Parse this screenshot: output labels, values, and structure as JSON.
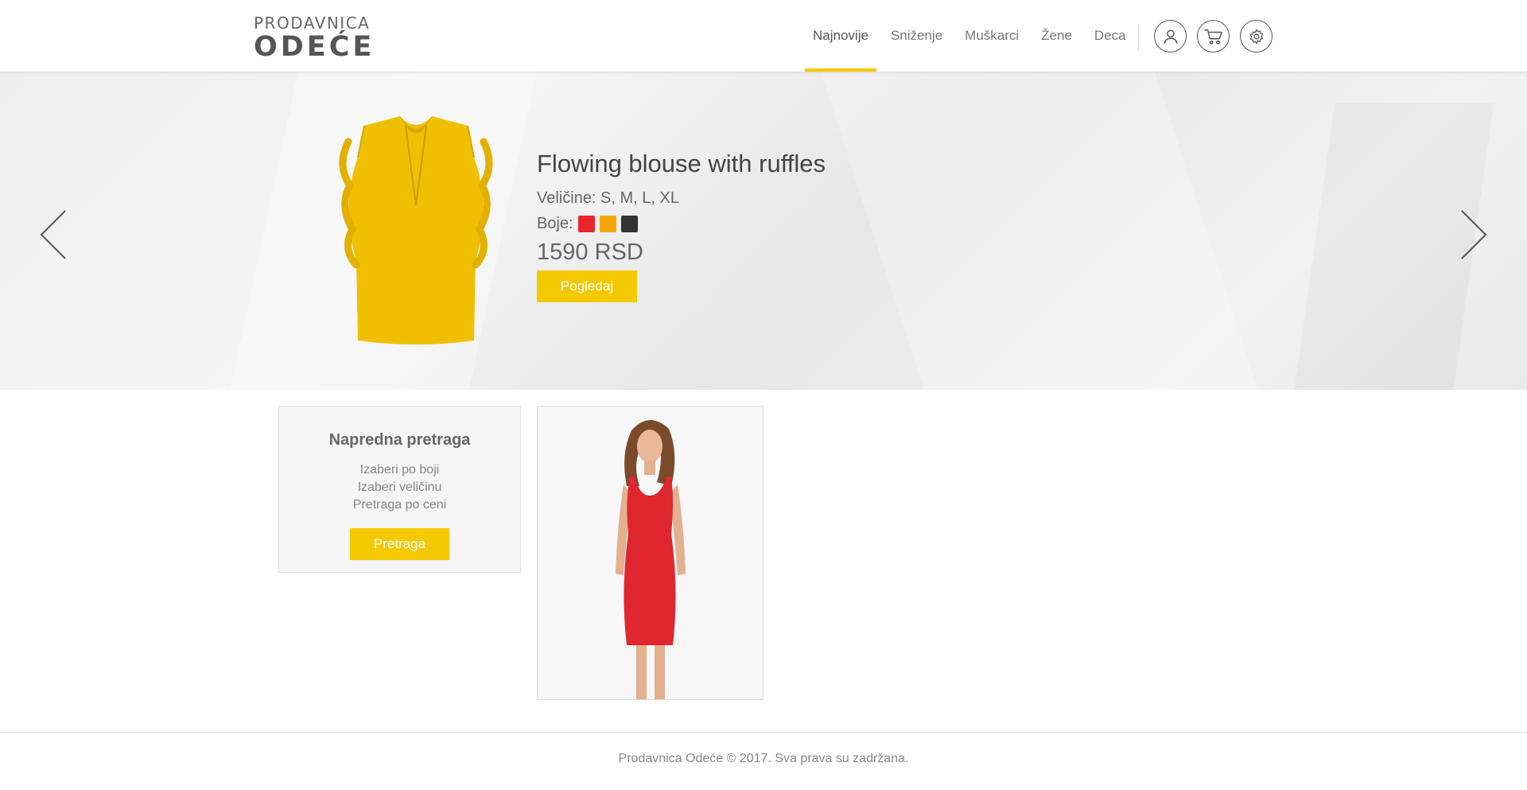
{
  "logo": {
    "top": "PRODAVNICA",
    "bottom": "ODEĆE"
  },
  "nav": {
    "items": [
      {
        "label": "Najnovije",
        "active": true
      },
      {
        "label": "Sniženje",
        "active": false
      },
      {
        "label": "Muškarci",
        "active": false
      },
      {
        "label": "Žene",
        "active": false
      },
      {
        "label": "Deca",
        "active": false
      }
    ],
    "icons": [
      "user-icon",
      "cart-icon",
      "settings-icon"
    ]
  },
  "hero": {
    "title": "Flowing blouse with ruffles",
    "sizes": "Veličine: S, M, L, XL",
    "colors_label": "Boje:",
    "colors": [
      "#e8262b",
      "#f5a300",
      "#333333"
    ],
    "price": "1590 RSD",
    "button": "Pogledaj"
  },
  "search": {
    "title": "Napredna pretraga",
    "links": [
      "Izaberi po boji",
      "Izaberi veličinu",
      "Pretraga po ceni"
    ],
    "button": "Pretraga"
  },
  "footer": {
    "text": "Prodavnica Odeće © 2017. Sva prava su zadržana."
  },
  "colors": {
    "accent": "#f5c900"
  }
}
